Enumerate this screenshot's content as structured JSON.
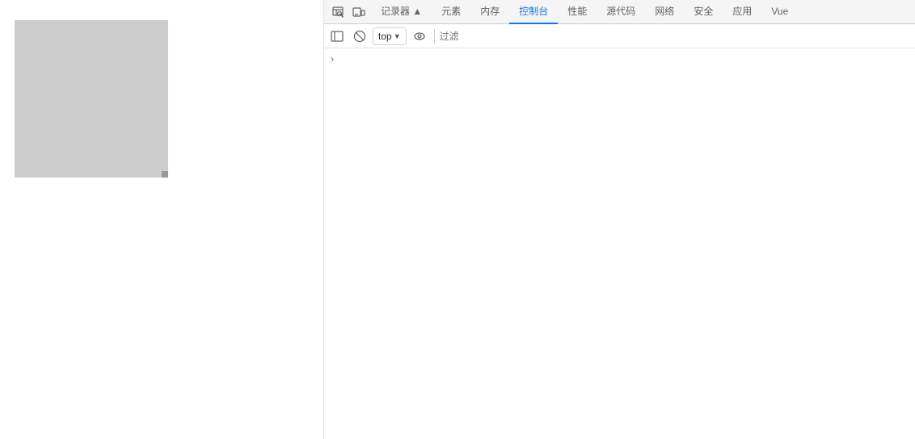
{
  "leftPanel": {
    "label": "webpage-preview"
  },
  "devtools": {
    "tabs": [
      {
        "id": "recorder",
        "label": "记录器 ▲",
        "active": false
      },
      {
        "id": "elements",
        "label": "元素",
        "active": false
      },
      {
        "id": "memory",
        "label": "内存",
        "active": false
      },
      {
        "id": "console",
        "label": "控制台",
        "active": true
      },
      {
        "id": "performance",
        "label": "性能",
        "active": false
      },
      {
        "id": "sources",
        "label": "源代码",
        "active": false
      },
      {
        "id": "network",
        "label": "网络",
        "active": false
      },
      {
        "id": "security",
        "label": "安全",
        "active": false
      },
      {
        "id": "application",
        "label": "应用",
        "active": false
      },
      {
        "id": "vue",
        "label": "Vue",
        "active": false
      }
    ],
    "toolbar": {
      "context": "top",
      "filter_placeholder": "过滤",
      "icons": {
        "sidebar_toggle": "▶|",
        "clear": "⊘",
        "eye": "👁"
      }
    },
    "console": {
      "expand_arrow": "›"
    }
  }
}
